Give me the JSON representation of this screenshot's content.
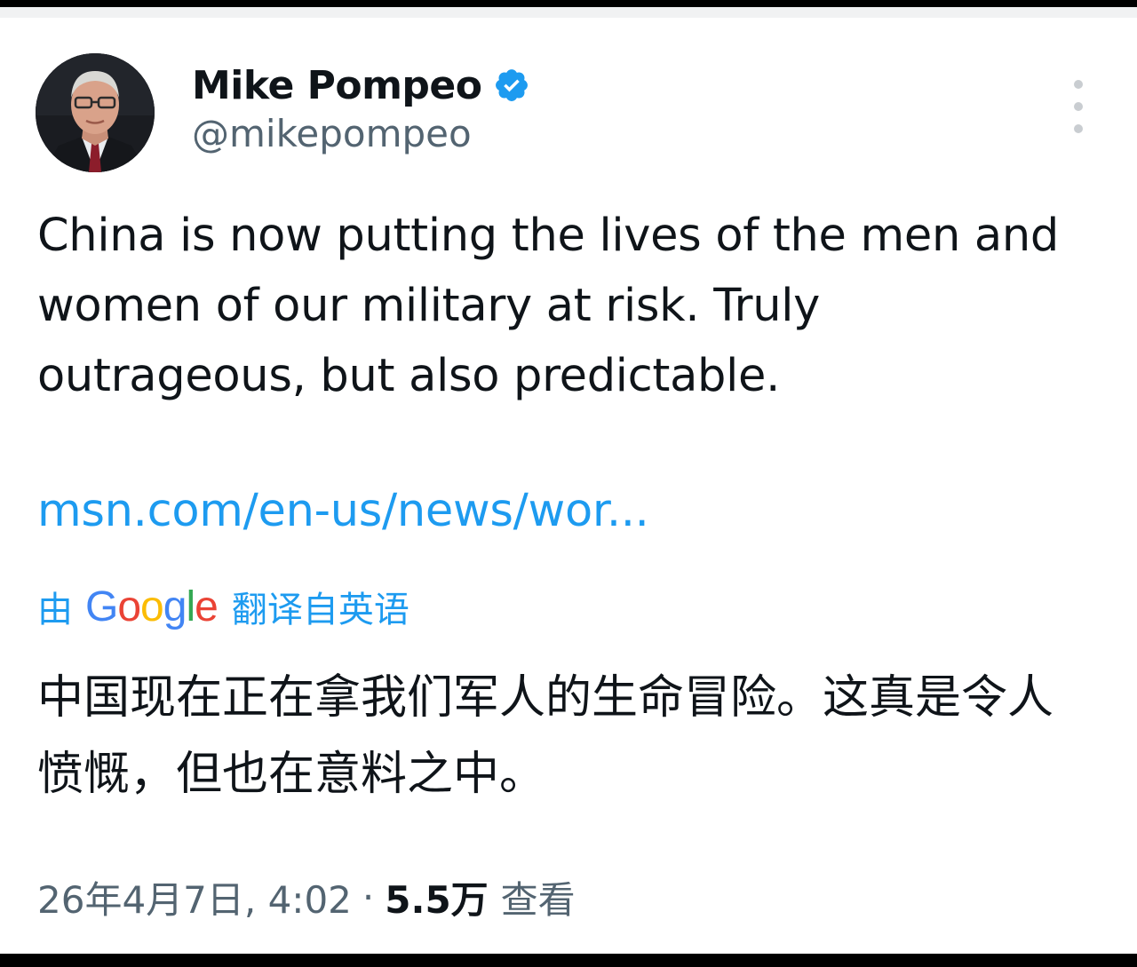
{
  "tweet": {
    "author": {
      "display_name": "Mike Pompeo",
      "handle": "@mikepompeo",
      "verified": true
    },
    "text": "China is now putting the lives of the men and women of our military at risk. Truly outrageous, but also predictable.",
    "link": "msn.com/en-us/news/wor...",
    "translation": {
      "prefix": "由",
      "provider": "Google",
      "suffix": "翻译自英语",
      "text": "中国现在正在拿我们军人的生命冒险。这真是令人愤慨，但也在意料之中。"
    },
    "meta": {
      "timestamp": "26年4月7日, 4:02",
      "separator": "·",
      "views_count": "5.5万",
      "views_label": "查看"
    }
  },
  "icons": {
    "verified": "verified-badge-icon",
    "more": "more-vertical-icon"
  },
  "colors": {
    "link": "#1d9bf0",
    "text_primary": "#0f1419",
    "text_secondary": "#536471",
    "verified": "#1d9bf0"
  }
}
